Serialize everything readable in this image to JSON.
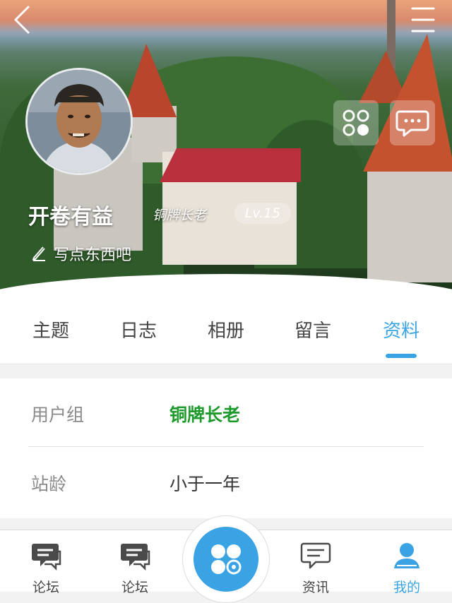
{
  "profile": {
    "username": "开卷有益",
    "rank": "铜牌长老",
    "level": "Lv.15",
    "signature_prompt": "写点东西吧"
  },
  "tabs": [
    {
      "label": "主题",
      "active": false
    },
    {
      "label": "日志",
      "active": false
    },
    {
      "label": "相册",
      "active": false
    },
    {
      "label": "留言",
      "active": false
    },
    {
      "label": "资料",
      "active": true
    }
  ],
  "info": {
    "rows": [
      {
        "label": "用户组",
        "value": "铜牌长老"
      },
      {
        "label": "站龄",
        "value": "小于一年"
      }
    ]
  },
  "bottom_nav": {
    "items": [
      {
        "label": "论坛",
        "icon": "chat-bubble-icon"
      },
      {
        "label": "论坛",
        "icon": "chat-bubble-icon"
      },
      {
        "label": "资讯",
        "icon": "message-icon"
      },
      {
        "label": "我的",
        "icon": "person-icon"
      }
    ],
    "center_icon": "apps-icon"
  },
  "colors": {
    "accent": "#3aa3e3",
    "rank_green": "#1f9a2d"
  }
}
